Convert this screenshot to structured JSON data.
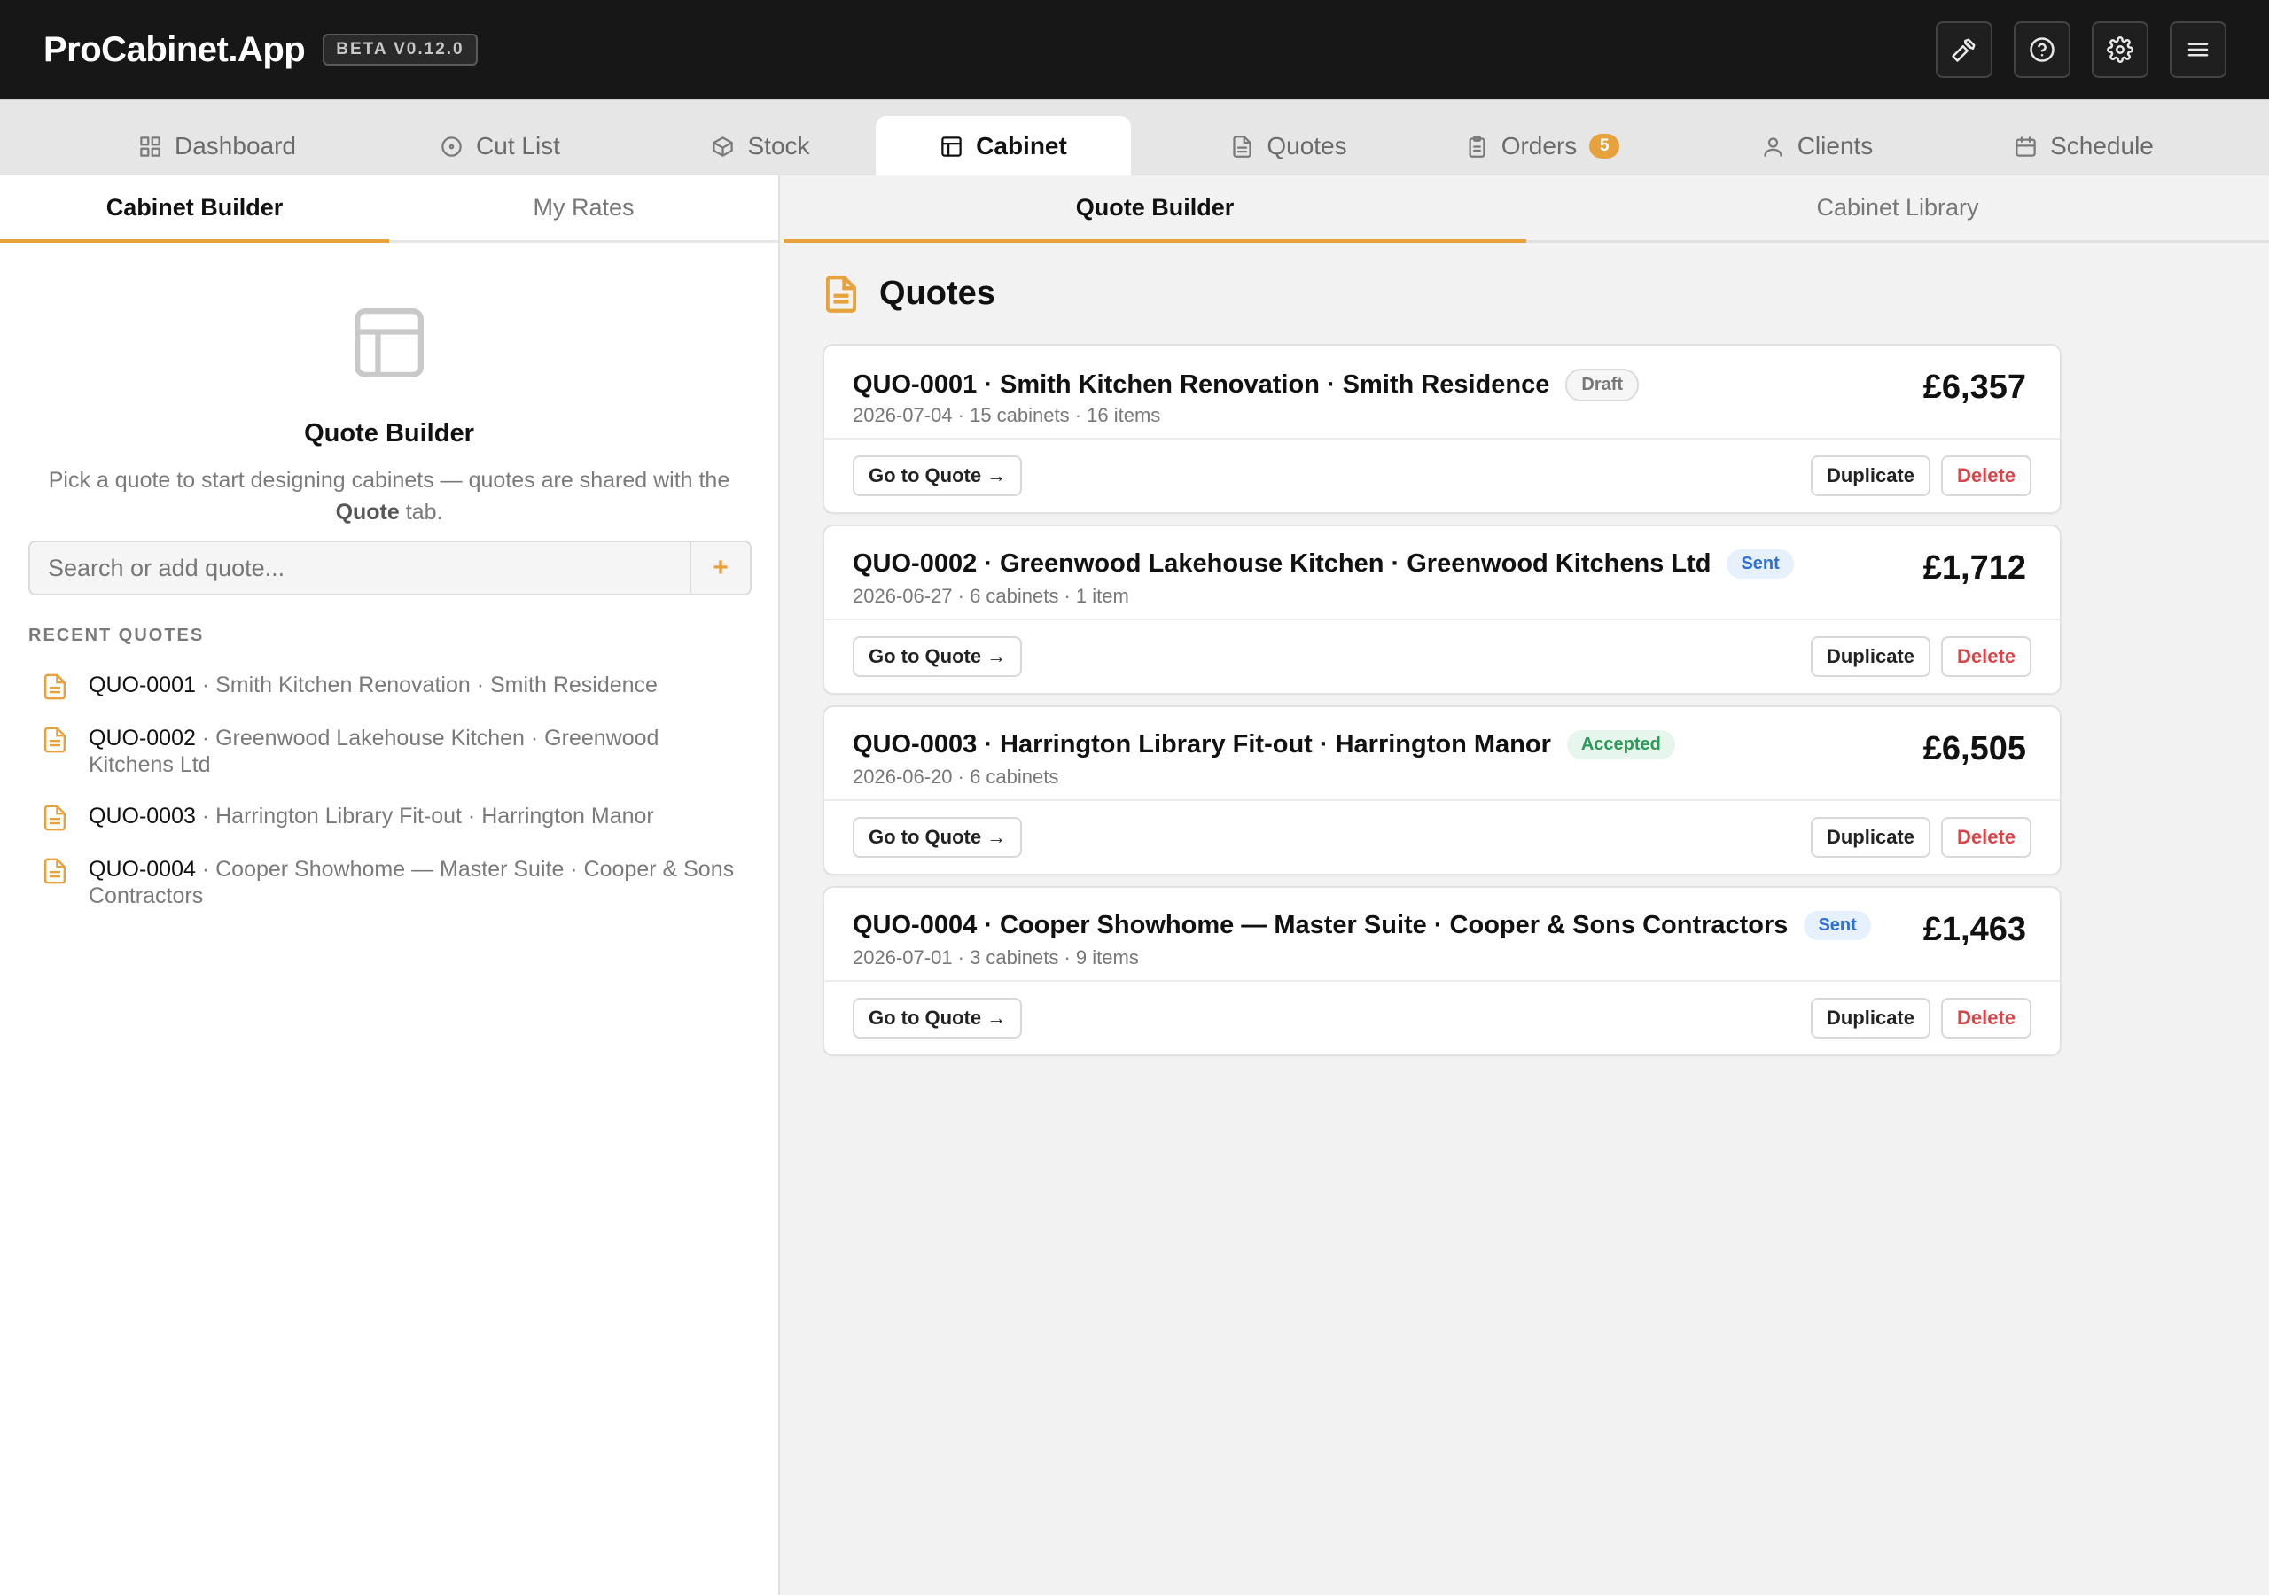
{
  "app": {
    "brand": "ProCabinet.App",
    "version_badge": "BETA V0.12.0"
  },
  "topbar": {
    "actions": [
      {
        "name": "tools-button",
        "icon": "hammer-icon"
      },
      {
        "name": "help-button",
        "icon": "help-circle-icon"
      },
      {
        "name": "settings-button",
        "icon": "gear-icon"
      },
      {
        "name": "menu-button",
        "icon": "hamburger-menu-icon"
      }
    ]
  },
  "nav": {
    "tabs": [
      {
        "label": "Dashboard",
        "icon": "grid-icon"
      },
      {
        "label": "Cut List",
        "icon": "target-icon"
      },
      {
        "label": "Stock",
        "icon": "box-icon"
      },
      {
        "label": "Cabinet",
        "icon": "layout-icon",
        "active": true
      },
      {
        "label": "Quotes",
        "icon": "document-icon"
      },
      {
        "label": "Orders",
        "icon": "clipboard-icon",
        "badge": "5"
      },
      {
        "label": "Clients",
        "icon": "user-icon"
      },
      {
        "label": "Schedule",
        "icon": "calendar-icon"
      }
    ]
  },
  "left": {
    "tabs": [
      {
        "label": "Cabinet Builder",
        "active": true
      },
      {
        "label": "My Rates"
      }
    ],
    "hero": {
      "icon": "layout-icon",
      "title": "Quote Builder",
      "desc_before": "Pick a quote to start designing cabinets — quotes are shared with the ",
      "desc_bold": "Quote",
      "desc_after": " tab."
    },
    "search": {
      "placeholder": "Search or add quote...",
      "value": "",
      "add_label": "+"
    },
    "recent_label": "RECENT QUOTES",
    "recent": [
      {
        "code": "QUO-0001",
        "rest": " · Smith Kitchen Renovation · Smith Residence"
      },
      {
        "code": "QUO-0002",
        "rest": " · Greenwood Lakehouse Kitchen · Greenwood Kitchens Ltd"
      },
      {
        "code": "QUO-0003",
        "rest": " · Harrington Library Fit-out · Harrington Manor"
      },
      {
        "code": "QUO-0004",
        "rest": " · Cooper Showhome — Master Suite · Cooper & Sons Contractors"
      }
    ]
  },
  "right": {
    "tabs": [
      {
        "label": "Quote Builder",
        "active": true
      },
      {
        "label": "Cabinet Library"
      }
    ],
    "heading": "Quotes",
    "buttons": {
      "goto": "Go to Quote →",
      "duplicate": "Duplicate",
      "delete": "Delete"
    },
    "quotes": [
      {
        "title": "QUO-0001 · Smith Kitchen Renovation · Smith Residence",
        "status": "Draft",
        "status_kind": "draft",
        "meta": "2026-07-04 · 15 cabinets · 16 items",
        "amount": "£6,357"
      },
      {
        "title": "QUO-0002 · Greenwood Lakehouse Kitchen · Greenwood Kitchens Ltd",
        "status": "Sent",
        "status_kind": "sent",
        "meta": "2026-06-27 · 6 cabinets · 1 item",
        "amount": "£1,712"
      },
      {
        "title": "QUO-0003 · Harrington Library Fit-out · Harrington Manor",
        "status": "Accepted",
        "status_kind": "accepted",
        "meta": "2026-06-20 · 6 cabinets",
        "amount": "£6,505"
      },
      {
        "title": "QUO-0004 · Cooper Showhome — Master Suite · Cooper & Sons Contractors",
        "status": "Sent",
        "status_kind": "sent",
        "meta": "2026-07-01 · 3 cabinets · 9 items",
        "amount": "£1,463"
      }
    ]
  },
  "colors": {
    "accent": "#e8a23c",
    "topbar": "#171717",
    "danger": "#d9464a",
    "sent": "#2f6fd6",
    "accepted": "#2e9a5a"
  }
}
